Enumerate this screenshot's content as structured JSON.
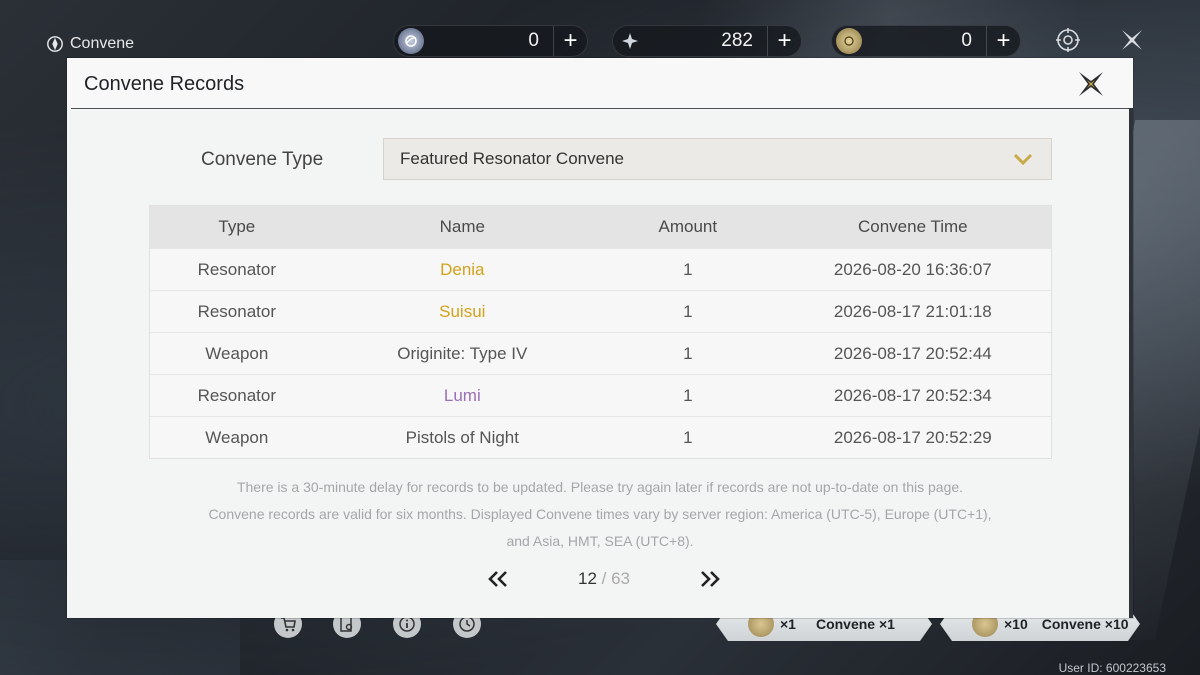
{
  "topbar": {
    "title": "Convene",
    "currencies": [
      {
        "icon": "astrite-icon",
        "value": "0"
      },
      {
        "icon": "lunite-icon",
        "value": "282"
      },
      {
        "icon": "radiant-tide-icon",
        "value": "0"
      }
    ]
  },
  "modal": {
    "title": "Convene Records",
    "type_label": "Convene Type",
    "selected_type": "Featured Resonator Convene",
    "columns": [
      "Type",
      "Name",
      "Amount",
      "Convene Time"
    ],
    "rows": [
      {
        "type": "Resonator",
        "name": "Denia",
        "amount": "1",
        "time": "2026-08-20 16:36:07",
        "rarity_color": "#d4a219"
      },
      {
        "type": "Resonator",
        "name": "Suisui",
        "amount": "1",
        "time": "2026-08-17 21:01:18",
        "rarity_color": "#d4a219"
      },
      {
        "type": "Weapon",
        "name": "Originite: Type IV",
        "amount": "1",
        "time": "2026-08-17 20:52:44",
        "rarity_color": "#555555"
      },
      {
        "type": "Resonator",
        "name": "Lumi",
        "amount": "1",
        "time": "2026-08-17 20:52:34",
        "rarity_color": "#9c6fb6"
      },
      {
        "type": "Weapon",
        "name": "Pistols of Night",
        "amount": "1",
        "time": "2026-08-17 20:52:29",
        "rarity_color": "#555555"
      }
    ],
    "notice_lines": [
      "There is a 30-minute delay for records to be updated. Please try again later if records are not up-to-date on this page.",
      "Convene records are valid for six months. Displayed Convene times vary by server region: America (UTC-5), Europe (UTC+1),",
      "and Asia, HMT, SEA (UTC+8)."
    ],
    "pager": {
      "current": "12",
      "separator": " / ",
      "total": "63"
    }
  },
  "bottombar": {
    "buttons": [
      {
        "count": "×1",
        "label": "Convene ×1"
      },
      {
        "count": "×10",
        "label": "Convene ×10"
      }
    ],
    "user_id": "User ID: 600223653"
  },
  "colors": {
    "gold": "#d4a219",
    "purple": "#9c6fb6",
    "accent": "#c9a94a"
  }
}
